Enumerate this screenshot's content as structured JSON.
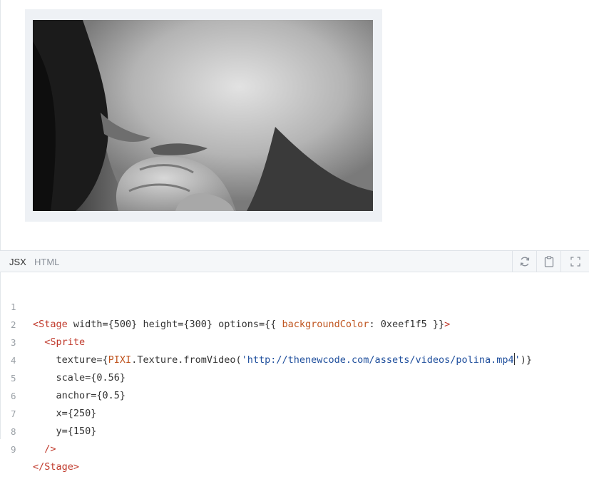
{
  "preview": {
    "background_color": "#eef1f5",
    "media": "video-frame-grayscale-portrait"
  },
  "toolbar": {
    "tabs": [
      {
        "label": "JSX",
        "active": true
      },
      {
        "label": "HTML",
        "active": false
      }
    ],
    "buttons": [
      {
        "icon": "reload-icon"
      },
      {
        "icon": "clipboard-icon"
      },
      {
        "icon": "fullscreen-icon"
      }
    ]
  },
  "editor": {
    "line_numbers": [
      "1",
      "2",
      "3",
      "4",
      "5",
      "6",
      "7",
      "8",
      "9"
    ],
    "lines": {
      "l1": {
        "open": "<Stage",
        "mid": " width={500} height={300} options={{ ",
        "key": "backgroundColor",
        "rest": ": 0xeef1f5 }}",
        "close": ">"
      },
      "l2": {
        "indent": "  ",
        "tag": "<Sprite"
      },
      "l3": {
        "indent": "    ",
        "prop": "texture={",
        "ident": "PIXI",
        "call": ".Texture.fromVideo(",
        "str_a": "'http://thenewcode.com/assets/videos/polina.mp4",
        "str_b": "'",
        "end": ")}"
      },
      "l4": {
        "text": "    scale={0.56}"
      },
      "l5": {
        "text": "    anchor={0.5}"
      },
      "l6": {
        "text": "    x={250}"
      },
      "l7": {
        "text": "    y={150}"
      },
      "l8": {
        "indent": "  ",
        "tag": "/>"
      },
      "l9": {
        "tag": "</Stage>"
      }
    }
  }
}
